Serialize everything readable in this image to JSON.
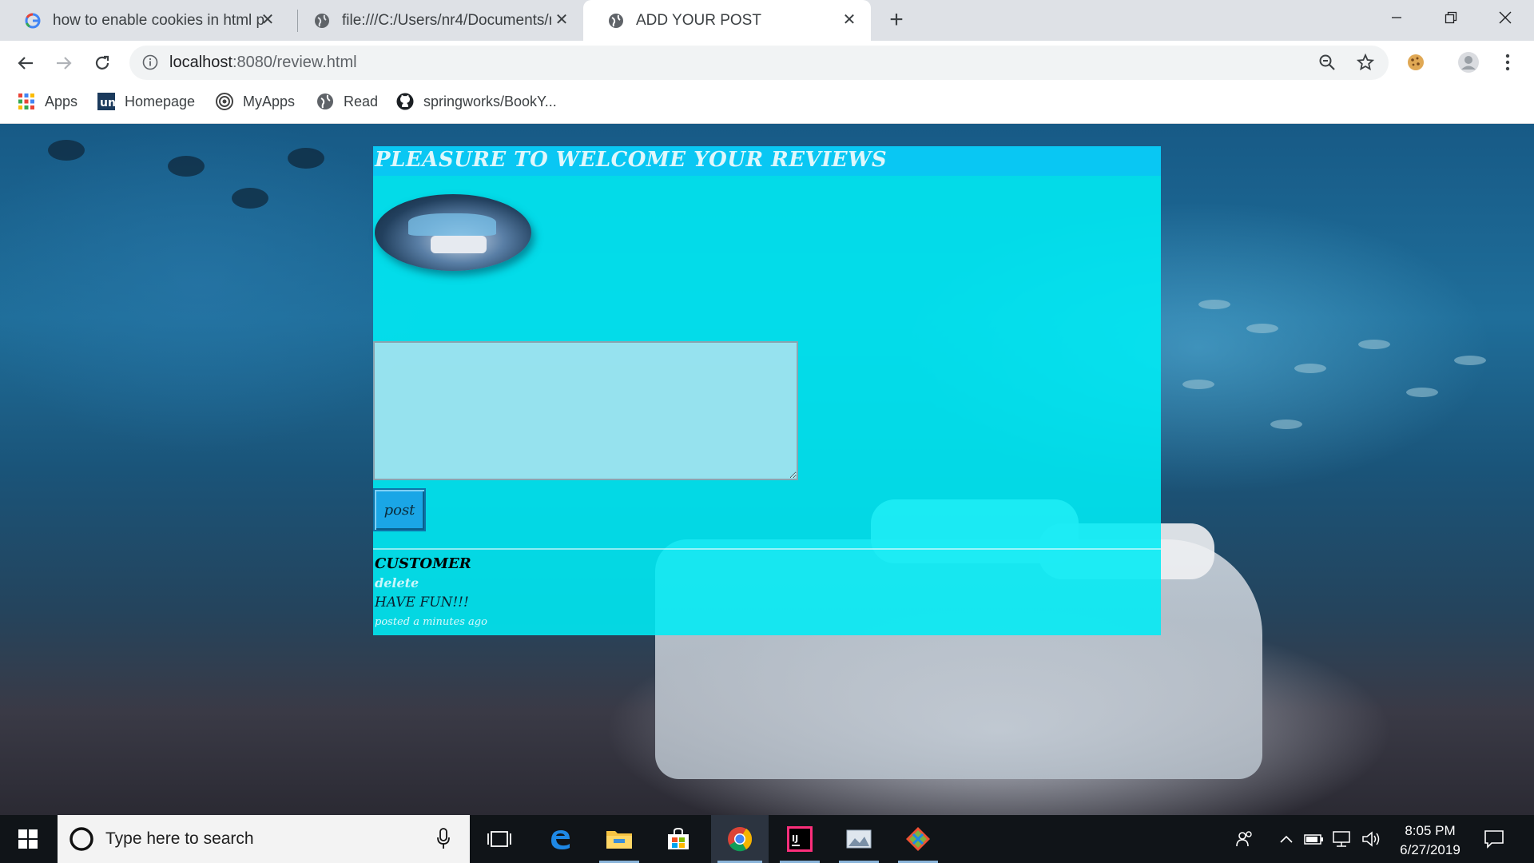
{
  "browser": {
    "tabs": [
      {
        "title": "how to enable cookies in html pa",
        "favicon": "google-icon",
        "active": false
      },
      {
        "title": "file:///C:/Users/nr4/Documents/n",
        "favicon": "globe-icon",
        "active": false
      },
      {
        "title": "ADD YOUR POST",
        "favicon": "globe-icon",
        "active": true
      }
    ],
    "url_host": "localhost",
    "url_rest": ":8080/review.html",
    "bookmarks": [
      {
        "label": "Apps",
        "icon": "apps-grid-icon"
      },
      {
        "label": "Homepage",
        "icon": "unacademy-icon"
      },
      {
        "label": "MyApps",
        "icon": "myapps-icon"
      },
      {
        "label": "Read",
        "icon": "globe-icon"
      },
      {
        "label": "springworks/BookY...",
        "icon": "github-icon"
      }
    ]
  },
  "page": {
    "title": "PLEASURE TO WELCOME YOUR REVIEWS",
    "post_button": "post",
    "review": {
      "author": "CUSTOMER",
      "delete_label": "delete",
      "body": "HAVE FUN!!!",
      "time": "posted a minutes ago"
    }
  },
  "taskbar": {
    "search_placeholder": "Type here to search",
    "time": "8:05 PM",
    "date": "6/27/2019"
  }
}
